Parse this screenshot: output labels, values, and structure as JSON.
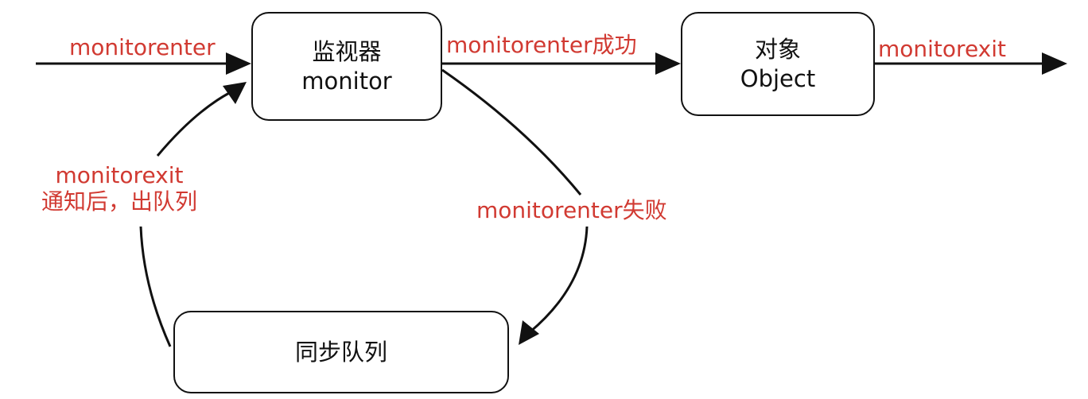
{
  "nodes": {
    "monitor": {
      "line1": "监视器",
      "line2": "monitor"
    },
    "object": {
      "line1": "对象",
      "line2": "Object"
    },
    "queue": {
      "label": "同步队列"
    }
  },
  "edges": {
    "enter": "monitorenter",
    "enter_success": "monitorenter成功",
    "exit": "monitorexit",
    "exit_notify": {
      "line1": "monitorexit",
      "line2": "通知后，出队列"
    },
    "enter_fail": "monitorenter失败"
  },
  "colors": {
    "edge_label": "#d13a32",
    "stroke": "#111111",
    "background": "#ffffff"
  }
}
